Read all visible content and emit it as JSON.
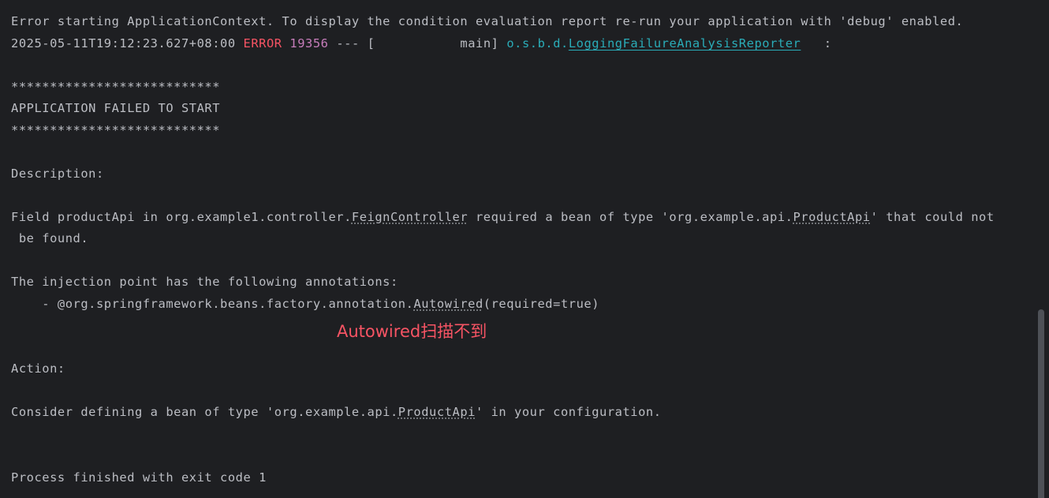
{
  "console": {
    "line_error_starting": "Error starting ApplicationContext. To display the condition evaluation report re-run your application with 'debug' enabled.",
    "log": {
      "timestamp": "2025-05-11T19:12:23.627+08:00",
      "level": "ERROR",
      "pid": "19356",
      "separator": "--- [",
      "thread": "           main]",
      "logger_prefix": "o.s.b.d.",
      "logger_class": "LoggingFailureAnalysisReporter",
      "colon": "   :"
    },
    "stars": "***************************",
    "failed_title": "APPLICATION FAILED TO START",
    "description_label": "Description:",
    "field_line": {
      "prefix": "Field productApi in org.example1.controller.",
      "controller_class": "FeignController",
      "middle": " required a bean of type 'org.example.api.",
      "api_class": "ProductApi",
      "suffix": "' that could not"
    },
    "field_line_cont": " be found.",
    "injection_line": "The injection point has the following annotations:",
    "annotation_line": {
      "prefix": "    - @org.springframework.beans.factory.annotation.",
      "autowired": "Autowired",
      "suffix": "(required=true)"
    },
    "action_label": "Action:",
    "consider_line": {
      "prefix": "Consider defining a bean of type 'org.example.api.",
      "api_class": "ProductApi",
      "suffix": "' in your configuration."
    },
    "process_finished": "Process finished with exit code 1"
  },
  "annotation_note": "Autowired扫描不到",
  "colors": {
    "background": "#1e1f22",
    "text": "#bcbec4",
    "error": "#f75464",
    "pid": "#c77dbb",
    "logger": "#2aacb8"
  }
}
